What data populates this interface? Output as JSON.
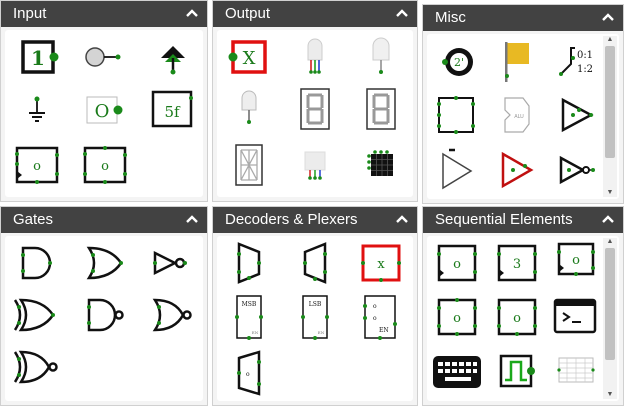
{
  "panels": {
    "input": {
      "title": "Input"
    },
    "output": {
      "title": "Output"
    },
    "misc": {
      "title": "Misc"
    },
    "gates": {
      "title": "Gates"
    },
    "decoders": {
      "title": "Decoders & Plexers"
    },
    "sequential": {
      "title": "Sequential Elements"
    }
  },
  "labels": {
    "const_one": "1",
    "digital_led": "O",
    "hex_input": "5f",
    "out_x": "X",
    "misc_counter": "2'",
    "misc_ratio_top": "0:1",
    "misc_ratio_bot": "1:2",
    "misc_alu": "ALU",
    "plexer_x": "x",
    "msb": "MSB",
    "lsb": "LSB",
    "en": "EN",
    "bit_o": "o",
    "seq_three": "3"
  },
  "colors": {
    "header": "#424242",
    "panel_bg": "#f4f4f4",
    "pin_green": "#1a8a1a",
    "highlight_red": "#e01010",
    "label_green": "#1a7a1a",
    "flag_yellow": "#e8b923"
  }
}
